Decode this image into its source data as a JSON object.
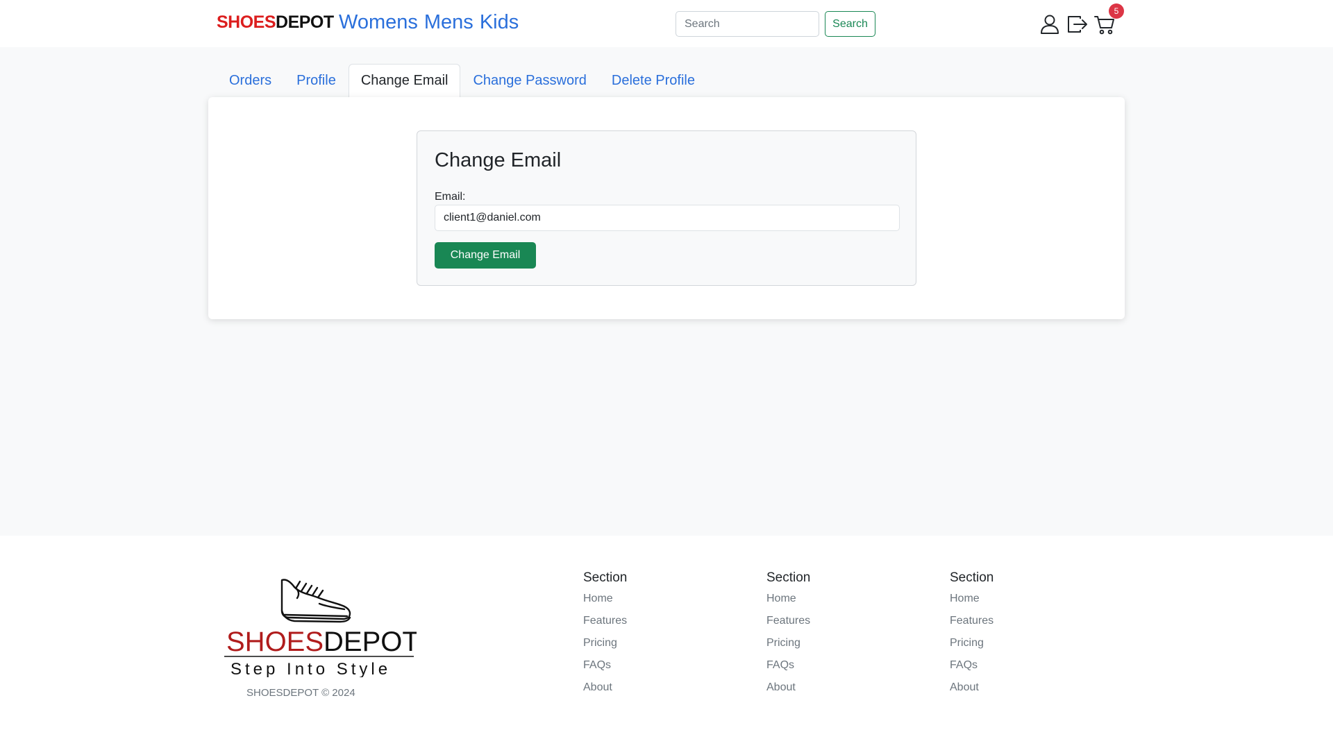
{
  "header": {
    "brand_red": "SHOES",
    "brand_black": "DEPOT",
    "nav": [
      "Womens",
      "Mens",
      "Kids"
    ],
    "search_placeholder": "Search",
    "search_button": "Search",
    "cart_count": "5",
    "icons": [
      "user-icon",
      "logout-icon",
      "cart-icon"
    ]
  },
  "tabs": [
    {
      "label": "Orders",
      "active": false
    },
    {
      "label": "Profile",
      "active": false
    },
    {
      "label": "Change Email",
      "active": true
    },
    {
      "label": "Change Password",
      "active": false
    },
    {
      "label": "Delete Profile",
      "active": false
    }
  ],
  "form": {
    "title": "Change Email",
    "email_label": "Email:",
    "email_value": "client1@daniel.com",
    "submit_label": "Change Email"
  },
  "footer": {
    "logo_red": "SHOES",
    "logo_black": "DEPOT",
    "logo_tagline": "Step Into Style",
    "copyright": "SHOESDEPOT © 2024",
    "columns": [
      {
        "title": "Section",
        "links": [
          "Home",
          "Features",
          "Pricing",
          "FAQs",
          "About"
        ]
      },
      {
        "title": "Section",
        "links": [
          "Home",
          "Features",
          "Pricing",
          "FAQs",
          "About"
        ]
      },
      {
        "title": "Section",
        "links": [
          "Home",
          "Features",
          "Pricing",
          "FAQs",
          "About"
        ]
      }
    ]
  },
  "colors": {
    "brand_red": "#dc1e1e",
    "link_blue": "#2a6fdb",
    "success_green": "#198754",
    "badge_red": "#dc3545",
    "page_bg": "#f8f9fa"
  }
}
